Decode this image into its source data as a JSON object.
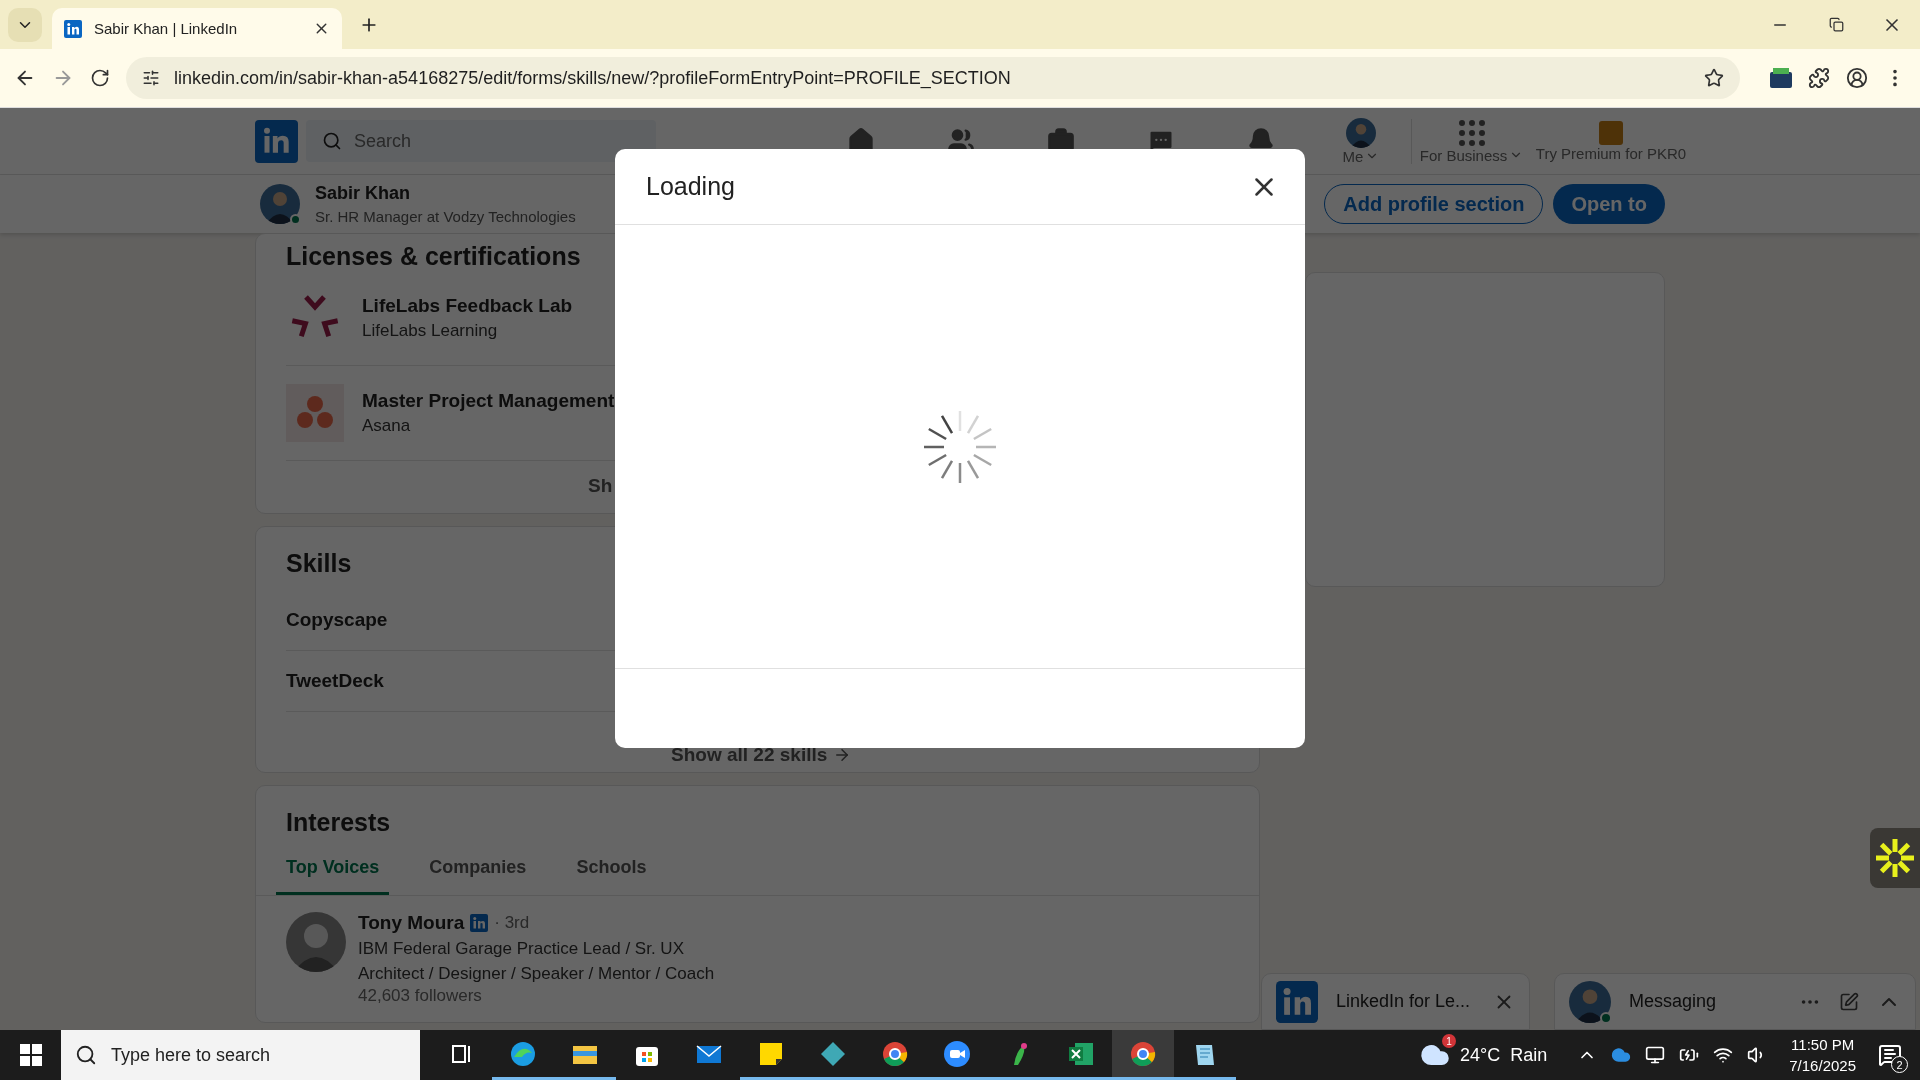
{
  "browser": {
    "tab_title": "Sabir Khan | LinkedIn",
    "url": "linkedin.com/in/sabir-khan-a54168275/edit/forms/skills/new/?profileFormEntryPoint=PROFILE_SECTION"
  },
  "nav": {
    "search_placeholder": "Search",
    "me": "Me",
    "business": "For Business",
    "premium": "Try Premium for PKR0"
  },
  "profile_bar": {
    "name": "Sabir Khan",
    "headline": "Sr. HR Manager at Vodzy Technologies",
    "online": true,
    "buttons": [
      {
        "label": "Add profile section",
        "kind": "outline"
      },
      {
        "label": "Open to",
        "kind": "primary"
      }
    ]
  },
  "licenses": {
    "title": "Licenses & certifications",
    "items": [
      {
        "name": "LifeLabs Feedback Lab",
        "issuer": "LifeLabs Learning",
        "kind": "spokes"
      },
      {
        "name": "Master Project Management",
        "issuer": "Asana",
        "kind": "dots"
      }
    ],
    "show_all": "Sh"
  },
  "skills": {
    "title": "Skills",
    "items": [
      "Copyscape",
      "TweetDeck"
    ],
    "show_all": "Show all 22 skills"
  },
  "interests": {
    "title": "Interests",
    "tabs": [
      {
        "label": "Top Voices",
        "selected": true
      },
      {
        "label": "Companies",
        "selected": false
      },
      {
        "label": "Schools",
        "selected": false
      }
    ],
    "person": {
      "name": "Tony Moura",
      "degree": "· 3rd",
      "headline": "IBM Federal Garage Practice Lead / Sr. UX Architect / Designer / Speaker / Mentor / Coach",
      "followers": "42,603 followers"
    }
  },
  "modal": {
    "title": "Loading"
  },
  "chat_bars": [
    {
      "kind": "promo",
      "title": "LinkedIn for Le..."
    },
    {
      "kind": "messaging",
      "title": "Messaging",
      "online": true
    }
  ],
  "taskbar": {
    "search_placeholder": "Type here to search",
    "apps": [
      {
        "kind": "taskview",
        "running": false,
        "selected": false
      },
      {
        "kind": "browser",
        "running": true,
        "selected": false
      },
      {
        "kind": "folder",
        "running": true,
        "selected": false
      },
      {
        "kind": "store",
        "running": false,
        "selected": false
      },
      {
        "kind": "mail",
        "running": false,
        "selected": false
      },
      {
        "kind": "note",
        "running": true,
        "selected": false
      },
      {
        "kind": "diamond",
        "running": true,
        "selected": false
      },
      {
        "kind": "chrome",
        "running": true,
        "selected": false
      },
      {
        "kind": "video",
        "running": true,
        "selected": false
      },
      {
        "kind": "bird",
        "running": true,
        "selected": false
      },
      {
        "kind": "sheet",
        "running": true,
        "selected": false
      },
      {
        "kind": "chrome",
        "running": true,
        "selected": true
      },
      {
        "kind": "notepad",
        "running": true,
        "selected": false
      }
    ],
    "weather": {
      "temperature": "24°C",
      "condition": "Rain",
      "badge": "1"
    },
    "time": "11:50 PM",
    "date": "7/16/2025",
    "notifications": "2"
  }
}
